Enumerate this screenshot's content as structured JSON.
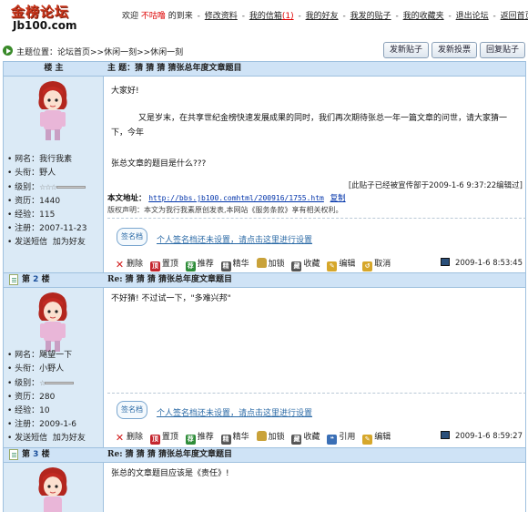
{
  "site": {
    "logo_cn": "金榜论坛",
    "logo_en": "Jb100.com"
  },
  "topnav": {
    "welcome": "欢迎",
    "nickname": "不咕噜",
    "arrived": "的到来",
    "edit_profile": "修改资料",
    "inbox": "我的信箱",
    "inbox_count": "(1)",
    "friends": "我的好友",
    "my_posts": "我发的贴子",
    "favorites": "我的收藏夹",
    "logout": "退出论坛",
    "home": "返回首页"
  },
  "location": {
    "label": "主题位置：",
    "path": "论坛首页>>休闲一刻>>休闲一刻"
  },
  "buttons": {
    "new_post": "发新贴子",
    "new_poll": "发新投票",
    "reply": "回复贴子"
  },
  "posts": [
    {
      "floor": "楼 主",
      "title": "主 题：猜 猜 猜 猜张总年度文章题目",
      "user": {
        "name": "我行我素",
        "title": "野人",
        "level_label": "级别：",
        "money": "1440",
        "exp": "115",
        "registered": "2007-11-23"
      },
      "labels": {
        "name": "• 网名：",
        "title": "• 头衔：",
        "level": "• 级别：",
        "money": "• 资历：",
        "exp": "• 经验：",
        "reg": "• 注册：",
        "msg": "• 发送短信",
        "add_friend": "加为好友"
      },
      "body": {
        "greeting": "大家好!",
        "para": "又是岁末，在共享世纪金榜快速发展成果的同时，我们再次期待张总一年一篇文章的问世，请大家猜一下，今年",
        "question": "张总文章的题目是什么???"
      },
      "edited": "[此贴子已经被宣传部于2009-1-6 9:37:22编辑过]",
      "url_label": "本文地址：",
      "url": "http://bbs.jb100.comhtml/200916/1755.htm",
      "copy": "复制",
      "copyright": "版权声明：本文为我行我素原创发表,本网站《服务条款》享有相关权利。",
      "sig_badge": "签名档",
      "sig_text": "个人签名档还未设置，请点击这里进行设置",
      "actions": [
        "删除",
        "置顶",
        "推荐",
        "精华",
        "加锁",
        "收藏",
        "编辑",
        "取消"
      ],
      "time": "2009-1-6 8:53:45"
    },
    {
      "floor_prefix": "第",
      "floor_num": "2",
      "floor_suffix": "楼",
      "title": "Re: 猜 猜 猜 猜张总年度文章题目",
      "user": {
        "name": "飓望一下",
        "title": "小野人",
        "money": "280",
        "exp": "10",
        "registered": "2009-1-6"
      },
      "body": {
        "text": "不好猜! 不过试一下，\"多难兴邦\""
      },
      "sig_badge": "签名档",
      "sig_text": "个人签名档还未设置，请点击这里进行设置",
      "actions": [
        "删除",
        "置顶",
        "推荐",
        "精华",
        "加锁",
        "收藏",
        "引用",
        "编辑"
      ],
      "time": "2009-1-6 8:59:27"
    },
    {
      "floor_prefix": "第",
      "floor_num": "3",
      "floor_suffix": "楼",
      "title": "Re: 猜 猜 猜 猜张总年度文章题目",
      "body": {
        "text": "张总的文章题目应该是《责任》!"
      }
    }
  ]
}
